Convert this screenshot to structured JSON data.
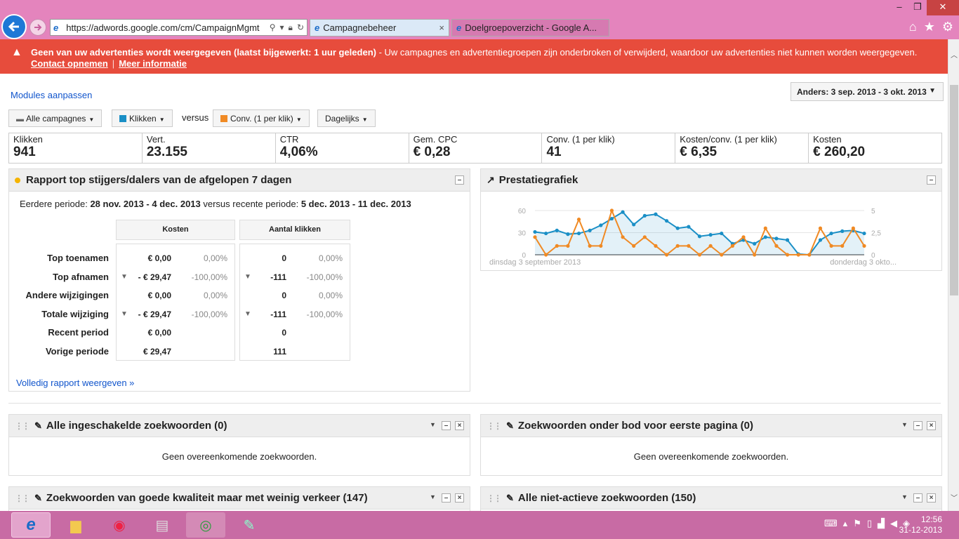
{
  "browser": {
    "url": "https://adwords.google.com/cm/CampaignMgmt",
    "tabs": [
      {
        "label": "Campagnebeheer",
        "close": "×"
      },
      {
        "label": "Doelgroepoverzicht - Google A..."
      }
    ],
    "window_controls": [
      "–",
      "❐",
      "✕"
    ]
  },
  "alert": {
    "bold_text": "Geen van uw advertenties wordt weergegeven (laatst bijgewerkt: 1 uur geleden)",
    "text": " - Uw campagnes en advertentiegroepen zijn onderbroken of verwijderd, waardoor uw advertenties niet kunnen worden weergegeven.",
    "contact_link": "Contact opnemen",
    "separator": "|",
    "more_link": "Meer informatie"
  },
  "toolbar": {
    "modules_link": "Modules aanpassen",
    "date_range": "Anders: 3 sep. 2013 - 3 okt. 2013",
    "campaigns_filter": "Alle campagnes",
    "metric1": "Klikken",
    "metric1_color": "#1a8fc6",
    "versus": "versus",
    "metric2": "Conv. (1 per klik)",
    "metric2_color": "#f08a24",
    "granularity": "Dagelijks"
  },
  "stats": [
    {
      "label": "Klikken",
      "value": "941"
    },
    {
      "label": "Vert.",
      "value": "23.155"
    },
    {
      "label": "CTR",
      "value": "4,06%"
    },
    {
      "label": "Gem. CPC",
      "value": "€ 0,28"
    },
    {
      "label": "Conv. (1 per klik)",
      "value": "41"
    },
    {
      "label": "Kosten/conv. (1 per klik)",
      "value": "€ 6,35"
    },
    {
      "label": "Kosten",
      "value": "€ 260,20"
    }
  ],
  "report": {
    "title": "Rapport top stijgers/dalers van de afgelopen 7 dagen",
    "period_prefix": "Eerdere periode: ",
    "earlier_period": "28 nov. 2013 - 4 dec. 2013",
    "period_mid": " versus recente periode: ",
    "recent_period": "5 dec. 2013 - 11 dec. 2013",
    "col_kosten": "Kosten",
    "col_klikken": "Aantal klikken",
    "rows": [
      {
        "label": "Top toenamen",
        "kosten": "€ 0,00",
        "kosten_pct": "0,00%",
        "klik": "0",
        "klik_pct": "0,00%",
        "down": false
      },
      {
        "label": "Top afnamen",
        "kosten": "- € 29,47",
        "kosten_pct": "-100,00%",
        "klik": "-111",
        "klik_pct": "-100,00%",
        "down": true
      },
      {
        "label": "Andere wijzigingen",
        "kosten": "€ 0,00",
        "kosten_pct": "0,00%",
        "klik": "0",
        "klik_pct": "0,00%",
        "down": false
      },
      {
        "label": "Totale wijziging",
        "kosten": "- € 29,47",
        "kosten_pct": "-100,00%",
        "klik": "-111",
        "klik_pct": "-100,00%",
        "down": true
      },
      {
        "label": "Recent period",
        "kosten": "€ 0,00",
        "kosten_pct": "",
        "klik": "0",
        "klik_pct": "",
        "down": false
      },
      {
        "label": "Vorige periode",
        "kosten": "€ 29,47",
        "kosten_pct": "",
        "klik": "111",
        "klik_pct": "",
        "down": false
      }
    ],
    "full_report_link": "Volledig rapport weergeven »",
    "collapse": "–"
  },
  "chart_panel": {
    "title": "Prestatiegrafiek",
    "collapse": "–"
  },
  "chart_data": {
    "type": "line",
    "x_start_label": "dinsdag 3 september 2013",
    "x_end_label": "donderdag 3 okto...",
    "left_axis_ticks": [
      "60",
      "30",
      "0"
    ],
    "right_axis_ticks": [
      "5",
      "2,5",
      "0"
    ],
    "ylim_left": [
      0,
      60
    ],
    "ylim_right": [
      0,
      5
    ],
    "series": [
      {
        "name": "Klikken",
        "axis": "left",
        "color": "#1a8fc6",
        "values": [
          31,
          29,
          33,
          28,
          29,
          33,
          40,
          49,
          58,
          41,
          53,
          55,
          46,
          36,
          38,
          25,
          27,
          29,
          15,
          20,
          15,
          24,
          22,
          20,
          1,
          0,
          20,
          29,
          32,
          33,
          29
        ]
      },
      {
        "name": "Conv. (1 per klik)",
        "axis": "right",
        "color": "#f08a24",
        "values": [
          2,
          0,
          1,
          1,
          4,
          1,
          1,
          5,
          2,
          1,
          2,
          1,
          0,
          1,
          1,
          0,
          1,
          0,
          1,
          2,
          0,
          3,
          1,
          0,
          0,
          0,
          3,
          1,
          1,
          3,
          1
        ]
      }
    ]
  },
  "keyword_panels": [
    {
      "title": "Alle ingeschakelde zoekwoorden (0)",
      "empty": "Geen overeenkomende zoekwoorden."
    },
    {
      "title": "Zoekwoorden onder bod voor eerste pagina (0)",
      "empty": "Geen overeenkomende zoekwoorden."
    },
    {
      "title": "Zoekwoorden van goede kwaliteit maar met weinig verkeer (147)"
    },
    {
      "title": "Alle niet-actieve zoekwoorden (150)"
    }
  ],
  "panel_controls": {
    "menu": "▼",
    "minimize": "–",
    "close": "×"
  },
  "taskbar": {
    "icons": [
      "internet-explorer-icon",
      "file-explorer-icon",
      "photos-icon",
      "media-icon",
      "chrome-icon",
      "paint-icon"
    ],
    "time": "12:56",
    "date": "31-12-2013"
  }
}
